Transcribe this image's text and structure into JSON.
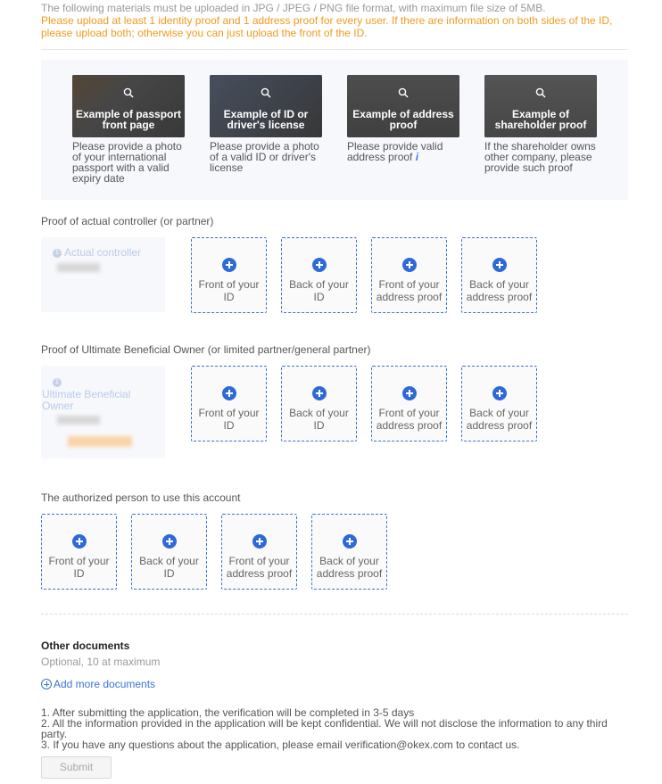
{
  "notes": {
    "format": "The following materials must be uploaded in JPG / JPEG / PNG file format, with maximum file size of 5MB.",
    "requirement": "Please upload at least 1 identity proof and 1 address proof for every user. If there are information on both sides of the ID, please upload both; otherwise you can just upload the front of the ID."
  },
  "examples": [
    {
      "caption": "Example of passport front page",
      "desc": "Please provide a photo of your international passport with a valid expiry date",
      "icon": "search-icon"
    },
    {
      "caption": "Example of ID or driver's license",
      "desc": "Please provide a photo of a valid ID or driver's license",
      "icon": "search-icon"
    },
    {
      "caption": "Example of address proof",
      "desc": "Please provide valid address proof",
      "info": "i",
      "icon": "search-icon"
    },
    {
      "caption": "Example of shareholder proof",
      "desc": "If the shareholder owns other company, please provide such proof",
      "icon": "search-icon"
    }
  ],
  "sections": [
    {
      "title": "Proof of actual controller (or partner)",
      "role": "Actual controller",
      "badge": "1",
      "uploads": [
        "Front of your ID",
        "Back of your ID",
        "Front of your address proof",
        "Back of your address proof"
      ]
    },
    {
      "title": "Proof of Ultimate Beneficial Owner (or limited partner/general partner)",
      "role": "Ultimate Beneficial Owner",
      "badge": "1",
      "uploads": [
        "Front of your ID",
        "Back of your ID",
        "Front of your address proof",
        "Back of your address proof"
      ]
    },
    {
      "title": "The authorized person to use this account",
      "uploads": [
        "Front of your ID",
        "Back of your ID",
        "Front of your address proof",
        "Back of your address proof"
      ]
    }
  ],
  "other": {
    "title": "Other documents",
    "subtitle": "Optional, 10 at maximum",
    "add_label": "Add more documents"
  },
  "footnotes": [
    "1. After submitting the application, the verification will be completed in 3-5 days",
    "2. All the information provided in the application will be kept confidential. We will not disclose the information to any third party.",
    "3. If you have any questions about the application, please email verification@okex.com to contact us."
  ],
  "submit_label": "Submit",
  "colors": {
    "accent": "#2d6ad7",
    "warning": "#f39a1e",
    "panel": "#f7f8fc"
  }
}
